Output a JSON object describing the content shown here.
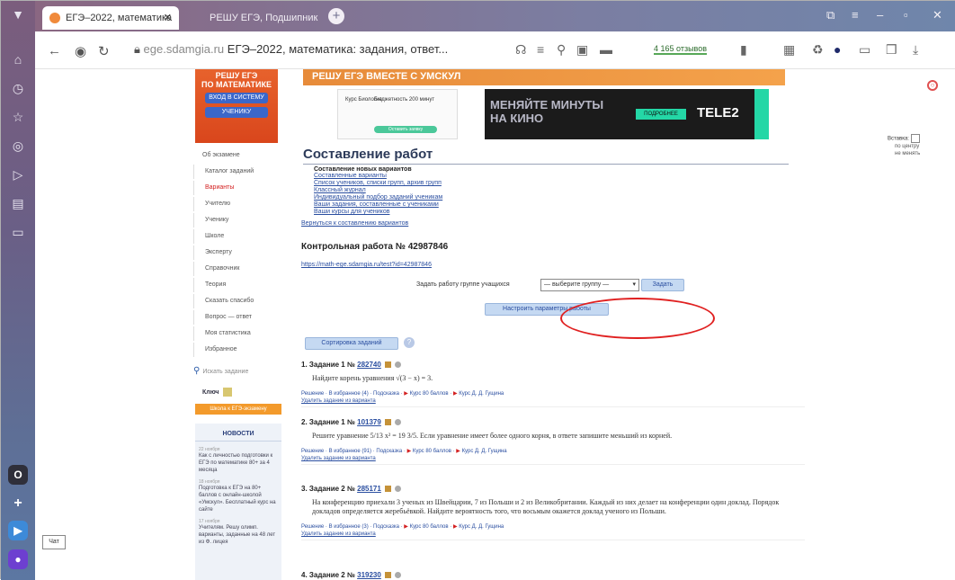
{
  "browser": {
    "tabs": [
      {
        "title": "ЕГЭ–2022, математика",
        "active": true
      },
      {
        "title": "РЕШУ ЕГЭ, Подшипник",
        "active": false
      }
    ],
    "url_domain": "ege.sdamgia.ru",
    "url_title": "ЕГЭ–2022, математика: задания, ответ...",
    "reviews": "4 165 отзывов"
  },
  "site": {
    "brand_line1": "РЕШУ ЕГЭ",
    "brand_line2": "ПО МАТЕМАТИКЕ",
    "brand_btn1": "ВХОД В СИСТЕМУ",
    "brand_btn2": "УЧЕНИКУ",
    "sidebar": [
      {
        "label": "Об экзамене"
      },
      {
        "label": "Каталог заданий"
      },
      {
        "label": "Варианты"
      },
      {
        "label": "Учителю"
      },
      {
        "label": "Ученику"
      },
      {
        "label": "Школе"
      },
      {
        "label": "Эксперту"
      },
      {
        "label": "Справочник"
      },
      {
        "label": "Теория"
      },
      {
        "label": "Сказать спасибо"
      },
      {
        "label": "Вопрос — ответ"
      },
      {
        "label": "Моя статистика"
      },
      {
        "label": "Избранное"
      }
    ],
    "search_placeholder": "Искать задание",
    "code_label": "Ключ",
    "orange_bar": "Школа к ЕГЭ-экзамену",
    "news_heading": "НОВОСТИ",
    "news": [
      {
        "date": "22 ноября",
        "text": "Как с личностью подготовки к ЕГЭ по математике 80+ за 4 месяца"
      },
      {
        "date": "18 ноября",
        "text": "Подготовка к ЕГЭ на 80+ баллов с онлайн-школой «Умскул». Бесплатный курс на сайте"
      },
      {
        "date": "17 ноября",
        "text": "Учителям. Решу олимп. варианты, заданные на 48 лет из Ф. лицея"
      }
    ]
  },
  "ads": {
    "top_strip": "РЕШУ ЕГЭ ВМЕСТЕ С УМСКУЛ",
    "left_l1": "Курс Биология",
    "left_l2": "Бюджетность 200 минут",
    "left_btn": "Оставить заявку",
    "right_text_1": "МЕНЯЙТЕ МИНУТЫ",
    "right_text_2": "НА КИНО",
    "right_pill": "ПОДРОБНЕЕ",
    "right_brand": "TELE2"
  },
  "main": {
    "title": "Составление работ",
    "links_heading": "Составление новых вариантов",
    "links": [
      "Составленные варианты",
      "Список учеников, списки групп, архив групп",
      "Классный журнал",
      "Индивидуальный подбор заданий ученикам",
      "Ваши задания, составленные с учениками",
      "Ваши курсы для учеников"
    ],
    "back_link": "Вернуться к составлению вариантов",
    "work_title": "Контрольная работа № 42987846",
    "work_url": "https://math-ege.sdamgia.ru/test?id=42987846",
    "assign_label": "Задать работу группе учащихся",
    "assign_select": "— выберите группу —",
    "assign_btn": "Задать",
    "setup_btn": "Настроить параметры работы",
    "sort_btn": "Сортировка заданий",
    "sort_help": "?"
  },
  "tasks": [
    {
      "head_prefix": "1. Задание 1 № ",
      "number": "282740",
      "body": "Найдите корень уравнения √(3 − x) = 3.",
      "links": [
        "Решение",
        "В избранное (4)",
        "Подсказка",
        "Курс 80 баллов",
        "Курс Д. Д. Гущина"
      ],
      "delete": "Удалить задание из варианта"
    },
    {
      "head_prefix": "2. Задание 1 № ",
      "number": "101379",
      "body": "Решите уравнение 5/13 x² = 19 3/5. Если уравнение имеет более одного корня, в ответе запишите меньший из корней.",
      "links": [
        "Решение",
        "В избранное (91)",
        "Подсказка",
        "Курс 80 баллов",
        "Курс Д. Д. Гущина"
      ],
      "delete": "Удалить задание из варианта"
    },
    {
      "head_prefix": "3. Задание 2 № ",
      "number": "285171",
      "body": "На конференцию приехали 3 ученых из Швейцарии, 7 из Польши и 2 из Великобритании. Каждый из них делает на конференции один доклад. Порядок докладов определяется жеребьёвкой. Найдите вероятность того, что восьмым окажется доклад ученого из Польши.",
      "links": [
        "Решение",
        "В избранное (3)",
        "Подсказка",
        "Курс 80 баллов",
        "Курс Д. Д. Гущина"
      ],
      "delete": "Удалить задание из варианта"
    },
    {
      "head_prefix": "4. Задание 2 № ",
      "number": "319230",
      "body": "",
      "links": [],
      "delete": ""
    }
  ],
  "right_widget": {
    "label": "Вставка:",
    "opt1": "по центру",
    "opt2": "не менять"
  },
  "chat_label": "Чат"
}
